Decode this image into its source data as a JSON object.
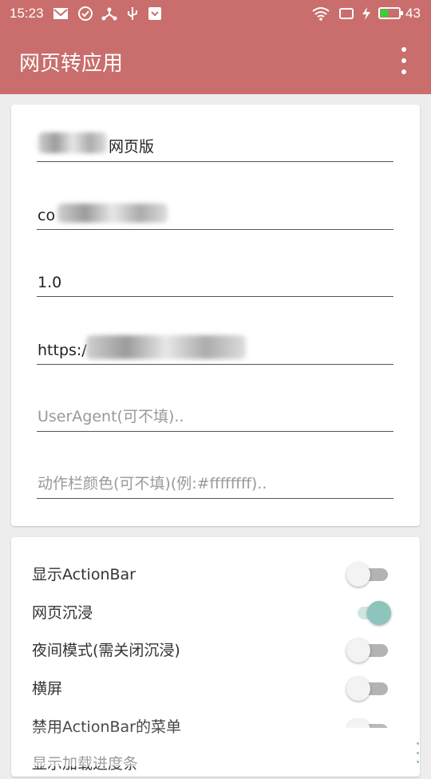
{
  "status_bar": {
    "time": "15:23",
    "battery_level": "43",
    "battery_fill_fraction": 0.43,
    "battery_color": "#32d432",
    "icons": [
      "mail-icon",
      "check-circle-icon",
      "share-icon",
      "usb-icon",
      "shield-icon",
      "wifi-icon",
      "screen-icon",
      "charging-icon"
    ]
  },
  "app_bar": {
    "title": "网页转应用",
    "bg_color": "#c96e6c",
    "menu_icon": "more-vert-icon"
  },
  "form": {
    "name_value": "网页版",
    "package_value": "co",
    "version_value": "1.0",
    "url_value": "https:/",
    "useragent_placeholder": "UserAgent(可不填)..",
    "actionbar_color_placeholder": "动作栏颜色(可不填)(例:#ffffffff).."
  },
  "settings": [
    {
      "label": "显示ActionBar",
      "on": false
    },
    {
      "label": "网页沉浸",
      "on": true
    },
    {
      "label": "夜间模式(需关闭沉浸)",
      "on": false
    },
    {
      "label": "横屏",
      "on": false
    },
    {
      "label": "禁用ActionBar的菜单",
      "on": false
    },
    {
      "label": "显示加载进度条",
      "on": false
    }
  ],
  "switch_on_color": "#8dc4bd"
}
